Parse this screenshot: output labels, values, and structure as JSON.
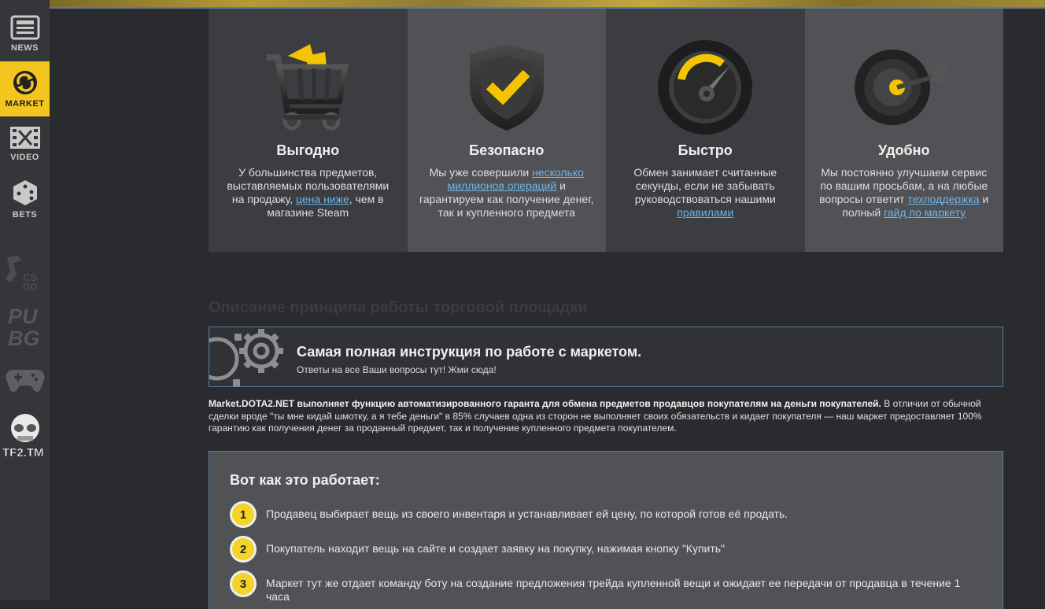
{
  "sidebar": {
    "items": [
      {
        "label": "NEWS",
        "icon": "newspaper-icon"
      },
      {
        "label": "MARKET",
        "icon": "market-refresh-icon"
      },
      {
        "label": "VIDEO",
        "icon": "film-icon"
      },
      {
        "label": "BETS",
        "icon": "dice-icon"
      }
    ],
    "games": [
      "CS GO",
      "PUBG",
      "GAMEPAD",
      "TF2.TM"
    ]
  },
  "features": [
    {
      "title": "Выгодно",
      "text1": "У большинства предметов, выставляемых пользователями на продажу, ",
      "link1": "цена ниже",
      "text2": ", чем в магазине Steam",
      "link2": "",
      "text3": ""
    },
    {
      "title": "Безопасно",
      "text1": "Мы уже совершили ",
      "link1": "несколько миллионов операций",
      "text2": " и гарантируем как получение денег, так и купленного предмета",
      "link2": "",
      "text3": ""
    },
    {
      "title": "Быстро",
      "text1": "Обмен занимает считанные секунды, если не забывать руководствоваться нашими ",
      "link1": "правилами",
      "text2": "",
      "link2": "",
      "text3": ""
    },
    {
      "title": "Удобно",
      "text1": "Мы постоянно улучшаем сервис по вашим просьбам, а на любые вопросы ответит ",
      "link1": "техподдержка",
      "text2": " и полный ",
      "link2": "гайд по маркету",
      "text3": ""
    }
  ],
  "section_title": "Описание принципа работы торговой площадки",
  "instruction": {
    "title": "Самая полная инструкция по работе с маркетом.",
    "subtitle": "Ответы на все Ваши вопросы тут! Жми сюда!"
  },
  "description": {
    "bold": "Market.DOTA2.NET выполняет функцию автоматизированного гаранта для обмена предметов продавцов покупателям на деньги покупателей.",
    "rest": " В отличии от обычной сделки вроде \"ты мне кидай шмотку, а я тебе деньги\" в 85% случаев одна из сторон не выполняет своих обязательств и кидает покупателя — наш маркет предоставляет 100% гарантию как получения денег за проданный предмет, так и получение купленного предмета покупателем."
  },
  "how": {
    "title": "Вот как это работает:",
    "steps": [
      {
        "num": "1",
        "text": "Продавец выбирает вещь из своего инвентаря и устанавливает ей цену, по которой готов её продать."
      },
      {
        "num": "2",
        "text": "Покупатель находит вещь на сайте и создает заявку на покупку, нажимая кнопку \"Купить\""
      },
      {
        "num": "3",
        "text": "Маркет тут же отдает команду боту на создание предложения трейда купленной вещи и ожидает ее передачи от продавца в течение 1 часа"
      }
    ]
  },
  "colors": {
    "accent": "#f2c61f",
    "link": "#6fb4e8",
    "border": "#5a7ca6"
  }
}
